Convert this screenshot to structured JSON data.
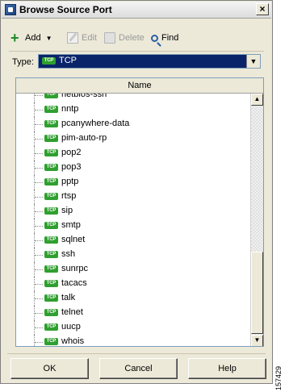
{
  "window": {
    "title": "Browse Source Port"
  },
  "toolbar": {
    "add_label": "Add",
    "edit_label": "Edit",
    "delete_label": "Delete",
    "find_label": "Find"
  },
  "type_field": {
    "label": "Type:",
    "value": "TCP",
    "badge": "TCP"
  },
  "list": {
    "column_header": "Name",
    "badge": "TCP",
    "items": [
      "netbios-ssn",
      "nntp",
      "pcanywhere-data",
      "pim-auto-rp",
      "pop2",
      "pop3",
      "pptp",
      "rtsp",
      "sip",
      "smtp",
      "sqlnet",
      "ssh",
      "sunrpc",
      "tacacs",
      "talk",
      "telnet",
      "uucp",
      "whois"
    ]
  },
  "buttons": {
    "ok": "OK",
    "cancel": "Cancel",
    "help": "Help"
  },
  "figure_code": "157429",
  "colors": {
    "selection": "#0a246a",
    "tcp_badge": "#2fa02f",
    "dialog_bg": "#ece9d8"
  }
}
